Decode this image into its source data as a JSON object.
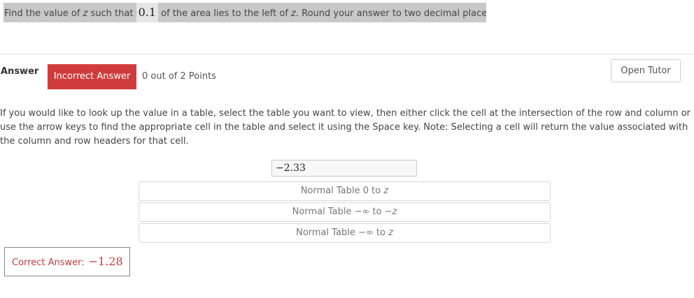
{
  "question": {
    "prefix": "Find the value of ",
    "var1": "z",
    "mid1": " such that ",
    "area": "0.1",
    "mid2": " of the area lies to the left of ",
    "var2": "z",
    "suffix": ". Round your answer to two decimal places."
  },
  "answer": {
    "label": "Answer",
    "status": "Incorrect Answer",
    "points": "0 out of 2 Points",
    "status_color": "#d03c3c"
  },
  "tutor_button": "Open Tutor",
  "instructions": "If you would like to look up the value in a table, select the table you want to view, then either click the cell at the intersection of the row and column or use the arrow keys to find the appropriate cell in the table and select it using the Space key. Note: Selecting a cell will return the value associated with the column and row headers for that cell.",
  "entered_value": "−2.33",
  "tables": [
    {
      "text": "Normal Table 0 to ",
      "var": "z"
    },
    {
      "text": "Normal Table −∞ to −",
      "var": "z"
    },
    {
      "text": "Normal Table −∞ to ",
      "var": "z"
    }
  ],
  "correct": {
    "label": "Correct Answer:",
    "value": "−1.28",
    "color": "#c23a3a"
  }
}
